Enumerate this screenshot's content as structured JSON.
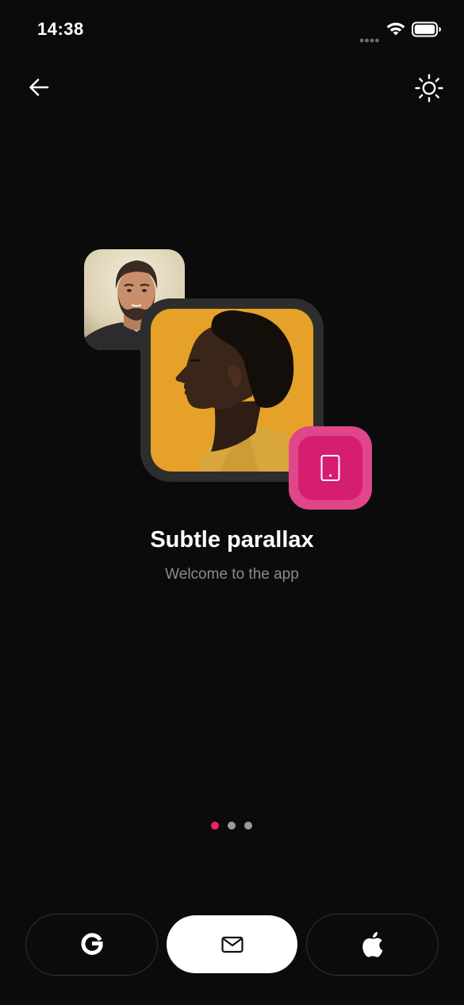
{
  "status_bar": {
    "time": "14:38",
    "icons": [
      "cellular-dots-icon",
      "wifi-icon",
      "battery-icon"
    ]
  },
  "nav": {
    "back_icon": "arrow-left-icon",
    "theme_icon": "sun-icon"
  },
  "illustration": {
    "avatar_small": "bearded-man-photo",
    "avatar_large": "profile-portrait-photo",
    "badge_icon": "smartphone-icon",
    "colors": {
      "photo_bg": "#e6a228",
      "badge_outer": "#e0468a",
      "badge_inner": "#d61e71"
    }
  },
  "onboarding": {
    "title": "Subtle parallax",
    "subtitle": "Welcome to the app"
  },
  "pager": {
    "count": 3,
    "active_index": 0,
    "colors": {
      "active": "#f0245c",
      "inactive": "#9a9a9a"
    }
  },
  "sign_in": {
    "buttons": [
      {
        "icon": "google-g-icon"
      },
      {
        "icon": "mail-icon"
      },
      {
        "icon": "apple-icon"
      }
    ]
  }
}
